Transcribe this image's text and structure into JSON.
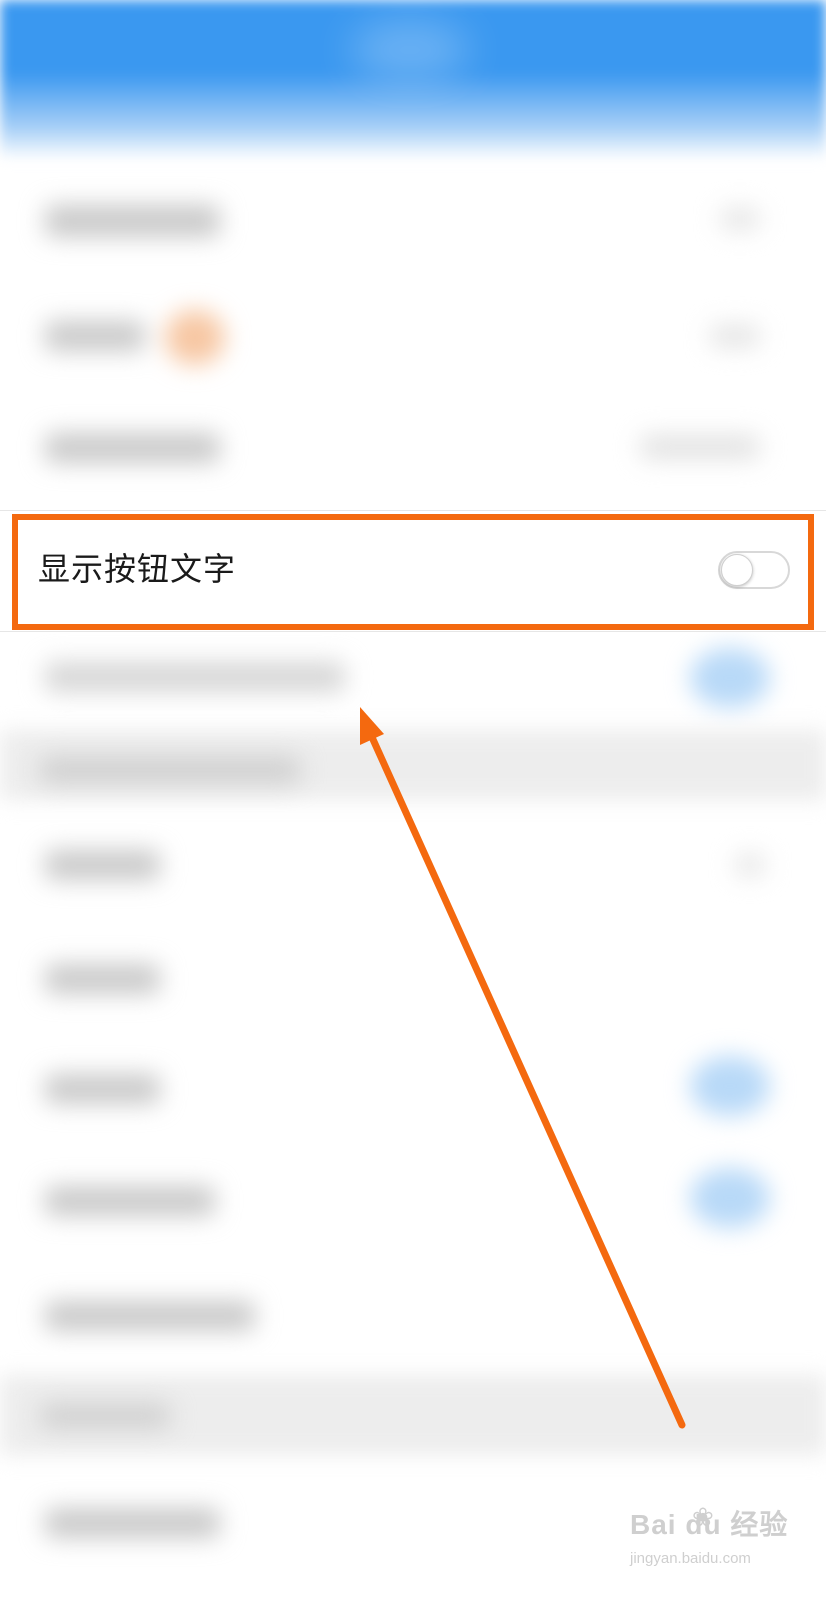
{
  "setting": {
    "label": "显示按钮文字",
    "toggle_on": false
  },
  "colors": {
    "header": "#3a98f0",
    "highlight": "#f4690f",
    "toggle_border": "#d8d8d8"
  },
  "watermark": {
    "main": "Bai du 经验",
    "sub": "jingyan.baidu.com",
    "icon": "paw-icon"
  }
}
